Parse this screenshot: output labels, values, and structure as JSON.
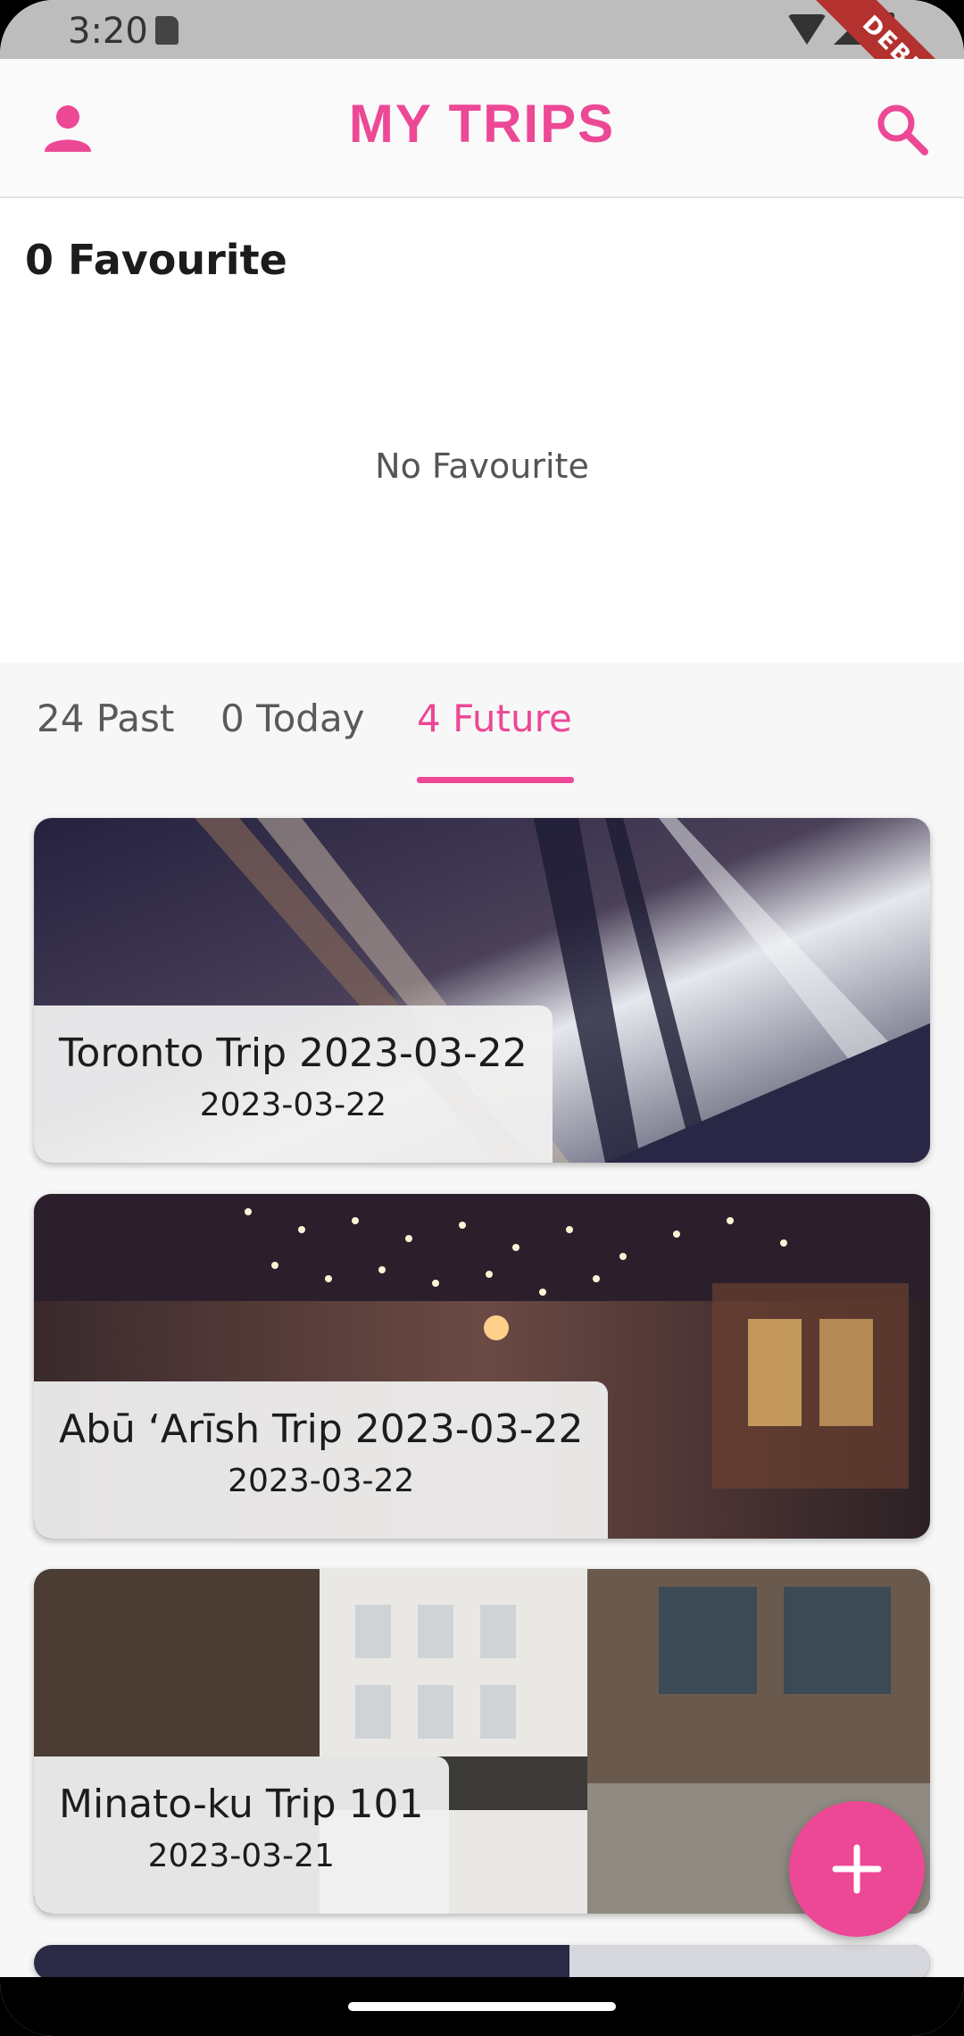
{
  "status_bar": {
    "time": "3:20",
    "debug": "DEBUG"
  },
  "app_bar": {
    "title": "MY TRIPS"
  },
  "favourites": {
    "count_label": "0 Favourite",
    "empty_text": "No Favourite"
  },
  "tabs": [
    {
      "label": "24 Past",
      "active": false
    },
    {
      "label": "0 Today",
      "active": false
    },
    {
      "label": "4 Future",
      "active": true
    }
  ],
  "trips": [
    {
      "title": "Toronto Trip 2023-03-22",
      "date": "2023-03-22"
    },
    {
      "title": "Abū ‘Arīsh Trip 2023-03-22",
      "date": "2023-03-22"
    },
    {
      "title": "Minato-ku Trip 101",
      "date": "2023-03-21"
    }
  ],
  "colors": {
    "accent": "#ec4896"
  },
  "icons": {
    "profile": "person-icon",
    "search": "search-icon",
    "fab": "plus-icon"
  }
}
